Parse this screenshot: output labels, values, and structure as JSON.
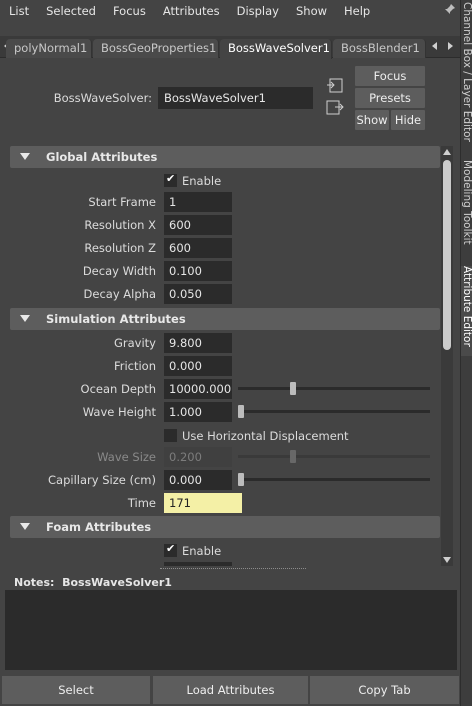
{
  "menu": [
    "List",
    "Selected",
    "Focus",
    "Attributes",
    "Display",
    "Show",
    "Help"
  ],
  "tabs": [
    "polyNormal1",
    "BossGeoProperties1",
    "BossWaveSolver1",
    "BossBlender1"
  ],
  "node": {
    "label": "BossWaveSolver:",
    "value": "BossWaveSolver1"
  },
  "buttons": {
    "focus": "Focus",
    "presets": "Presets",
    "show": "Show",
    "hide": "Hide"
  },
  "global": {
    "title": "Global Attributes",
    "enable_label": "Enable",
    "enable": true,
    "start_frame_label": "Start Frame",
    "start_frame": "1",
    "res_x_label": "Resolution X",
    "res_x": "600",
    "res_z_label": "Resolution Z",
    "res_z": "600",
    "decay_width_label": "Decay Width",
    "decay_width": "0.100",
    "decay_alpha_label": "Decay Alpha",
    "decay_alpha": "0.050"
  },
  "simulation": {
    "title": "Simulation Attributes",
    "gravity_label": "Gravity",
    "gravity": "9.800",
    "friction_label": "Friction",
    "friction": "0.000",
    "ocean_depth_label": "Ocean Depth",
    "ocean_depth": "10000.000",
    "ocean_depth_slider": 0.28,
    "wave_height_label": "Wave Height",
    "wave_height": "1.000",
    "wave_height_slider": 0.0,
    "horiz_disp_label": "Use Horizontal Displacement",
    "horiz_disp": false,
    "wave_size_label": "Wave Size",
    "wave_size": "0.200",
    "wave_size_slider": 0.28,
    "capillary_label": "Capillary Size (cm)",
    "capillary": "0.000",
    "capillary_slider": 0.0,
    "time_label": "Time",
    "time": "171"
  },
  "foam": {
    "title": "Foam Attributes",
    "enable_label": "Enable",
    "enable": true
  },
  "notes": {
    "label": "Notes:",
    "node": "BossWaveSolver1"
  },
  "bottom": {
    "select": "Select",
    "load": "Load Attributes",
    "copy": "Copy Tab"
  },
  "side_tabs": [
    "Channel Box / Layer Editor",
    "Modeling Toolkit",
    "Attribute Editor"
  ]
}
